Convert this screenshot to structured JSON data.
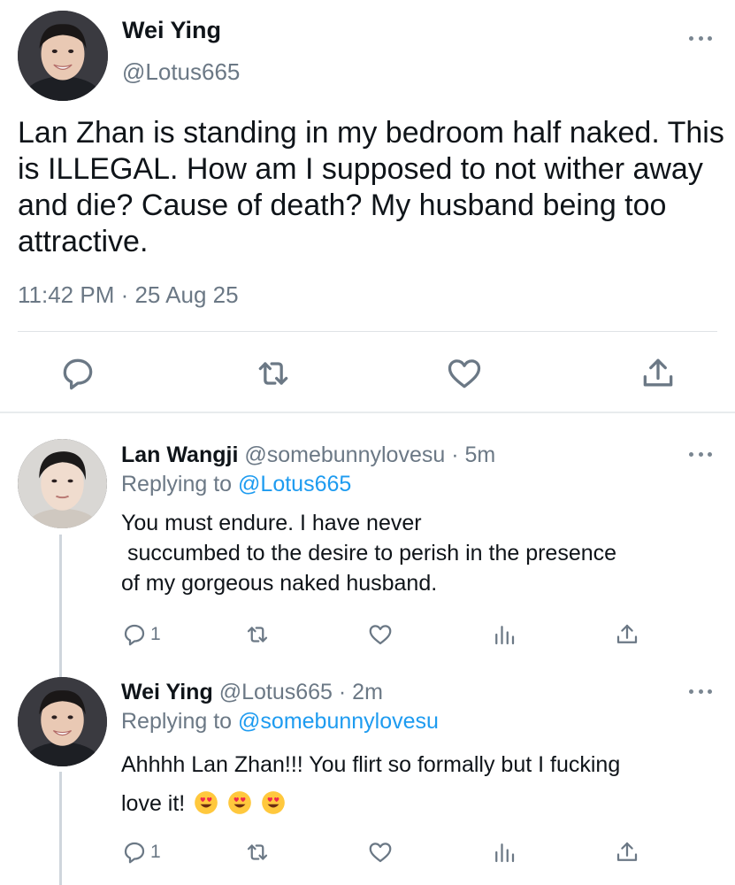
{
  "main_tweet": {
    "name": "Wei Ying",
    "handle": "@Lotus665",
    "text": "Lan Zhan is standing in my bedroom half naked. This is ILLEGAL. How am I supposed to not wither away and die? Cause of death? My husband being too attractive.",
    "timestamp": "11:42 PM · 25 Aug 25",
    "icons": [
      "reply-icon",
      "retweet-icon",
      "like-icon",
      "share-icon"
    ]
  },
  "replies": [
    {
      "name": "Lan Wangji",
      "handle": "@somebunnylovesu",
      "time": "· 5m",
      "replying_prefix": "Replying to ",
      "replying_to": "@Lotus665",
      "text_lines": [
        "You must endure. I have never",
        " succumbed to the desire to perish in the presence",
        "of my gorgeous naked husband."
      ],
      "reply_count": "1"
    },
    {
      "name": "Wei Ying",
      "handle": "@Lotus665",
      "time": "· 2m",
      "replying_prefix": "Replying to ",
      "replying_to": "@somebunnylovesu",
      "text_lines": [
        "Ahhhh Lan Zhan!!! You flirt so formally but I fucking",
        "love it!"
      ],
      "emojis": [
        "heart-eyes-emoji",
        "heart-eyes-emoji",
        "heart-eyes-emoji"
      ],
      "reply_count": "1"
    }
  ],
  "colors": {
    "text": "#0f1419",
    "secondary": "#6b7885",
    "link": "#1d9bf0",
    "divider": "#dfe3e6"
  }
}
